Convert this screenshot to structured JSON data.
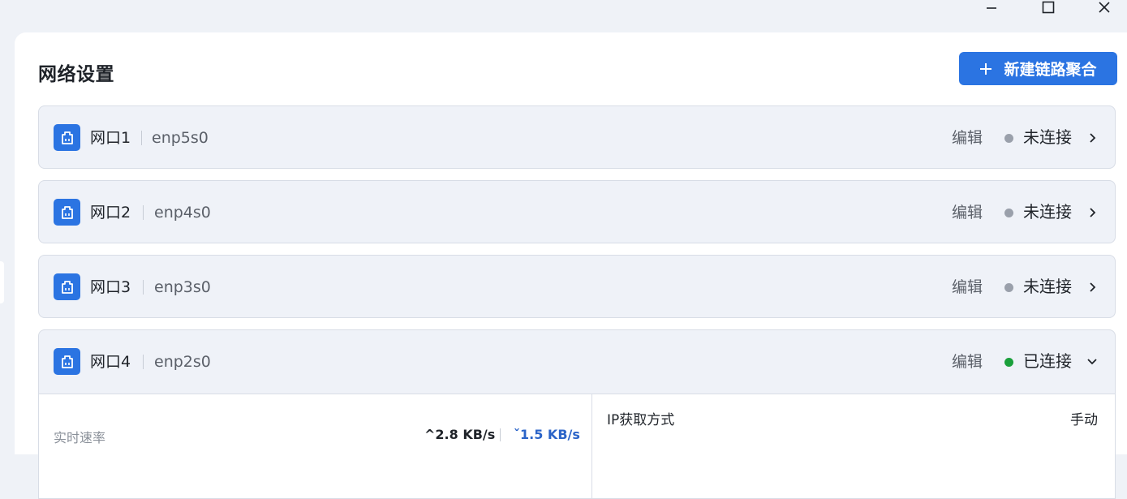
{
  "window": {
    "minimize_icon": "minimize-icon",
    "maximize_icon": "maximize-icon",
    "close_icon": "close-icon"
  },
  "page": {
    "title": "网络设置",
    "add_button_label": "新建链路聚合"
  },
  "ports": [
    {
      "name": "网口1",
      "iface": "enp5s0",
      "edit": "编辑",
      "status": "未连接",
      "connected": false
    },
    {
      "name": "网口2",
      "iface": "enp4s0",
      "edit": "编辑",
      "status": "未连接",
      "connected": false
    },
    {
      "name": "网口3",
      "iface": "enp3s0",
      "edit": "编辑",
      "status": "未连接",
      "connected": false
    },
    {
      "name": "网口4",
      "iface": "enp2s0",
      "edit": "编辑",
      "status": "已连接",
      "connected": true
    }
  ],
  "detail": {
    "speed_label": "实时速率",
    "upload": "^2.8 KB/s",
    "download": "ˇ1.5 KB/s",
    "ip_label": "IP获取方式",
    "ip_value": "手动"
  },
  "colors": {
    "accent": "#2b74e2",
    "connected": "#1aa03b",
    "disconnected": "#9aa0ab",
    "background": "#eff2f7"
  }
}
